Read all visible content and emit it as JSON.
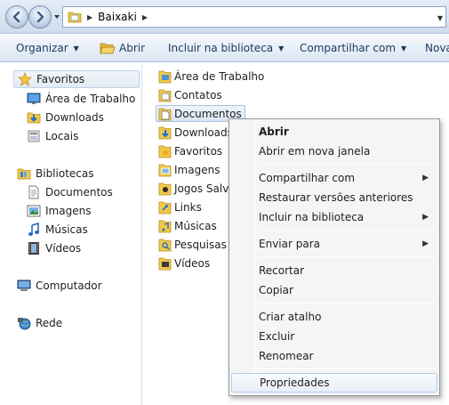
{
  "address_bar": {
    "crumb": "Baixaki"
  },
  "toolbar": {
    "organizar": "Organizar",
    "abrir": "Abrir",
    "incluir": "Incluir na biblioteca",
    "compartilhar": "Compartilhar com",
    "nova": "Nova"
  },
  "nav": {
    "favoritos": "Favoritos",
    "area_de_trabalho": "Área de Trabalho",
    "downloads": "Downloads",
    "locais": "Locais",
    "bibliotecas": "Bibliotecas",
    "documentos": "Documentos",
    "imagens": "Imagens",
    "musicas": "Músicas",
    "videos": "Vídeos",
    "computador": "Computador",
    "rede": "Rede"
  },
  "files": [
    {
      "label": "Área de Trabalho",
      "icon": "desktop-folder-icon"
    },
    {
      "label": "Contatos",
      "icon": "contacts-folder-icon"
    },
    {
      "label": "Documentos",
      "icon": "documents-folder-icon"
    },
    {
      "label": "Downloads",
      "icon": "downloads-folder-icon"
    },
    {
      "label": "Favoritos",
      "icon": "favorites-folder-icon"
    },
    {
      "label": "Imagens",
      "icon": "pictures-folder-icon"
    },
    {
      "label": "Jogos Salvo",
      "icon": "saved-games-folder-icon"
    },
    {
      "label": "Links",
      "icon": "links-folder-icon"
    },
    {
      "label": "Músicas",
      "icon": "music-folder-icon"
    },
    {
      "label": "Pesquisas",
      "icon": "searches-folder-icon"
    },
    {
      "label": "Vídeos",
      "icon": "videos-folder-icon"
    }
  ],
  "context_menu": {
    "abrir": "Abrir",
    "abrir_nova_janela": "Abrir em nova janela",
    "compartilhar_com": "Compartilhar com",
    "restaurar": "Restaurar versões anteriores",
    "incluir_biblioteca": "Incluir na biblioteca",
    "enviar_para": "Enviar para",
    "recortar": "Recortar",
    "copiar": "Copiar",
    "criar_atalho": "Criar atalho",
    "excluir": "Excluir",
    "renomear": "Renomear",
    "propriedades": "Propriedades"
  },
  "colors": {
    "toolbar_text": "#1e395b",
    "selection_border": "#a6c2e3",
    "folder_yellow": "#f0c94a"
  }
}
